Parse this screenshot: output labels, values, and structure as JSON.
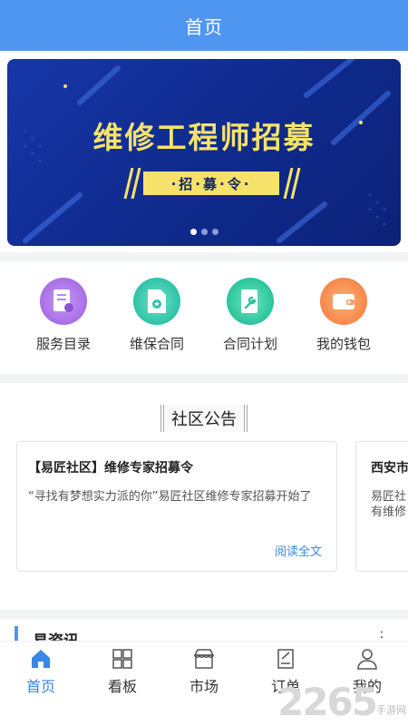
{
  "header": {
    "title": "首页"
  },
  "banner": {
    "title": "维修工程师招募",
    "tag": "·招·募·令·",
    "slides": 3,
    "active_slide": 0
  },
  "menu": {
    "items": [
      {
        "label": "服务目录",
        "icon": "certificate-icon",
        "color": "#a86ee6"
      },
      {
        "label": "维保合同",
        "icon": "contract-icon",
        "color": "#2fc2a8"
      },
      {
        "label": "合同计划",
        "icon": "wrench-doc-icon",
        "color": "#2bc49c"
      },
      {
        "label": "我的钱包",
        "icon": "wallet-icon",
        "color": "#f7874a"
      }
    ]
  },
  "notice": {
    "section_title": "社区公告",
    "cards": [
      {
        "title": "【易匠社区】维修专家招募令",
        "body": "“寻找有梦想实力派的你”易匠社区维修专家招募开始了",
        "more": "阅读全文"
      },
      {
        "title": "西安市",
        "body": "易匠社\n有维修",
        "more": ""
      }
    ]
  },
  "info": {
    "title": "易资讯",
    "more": "⋮"
  },
  "tabbar": {
    "items": [
      {
        "label": "首页",
        "icon": "home-icon",
        "active": true
      },
      {
        "label": "看板",
        "icon": "grid-icon",
        "active": false
      },
      {
        "label": "市场",
        "icon": "market-icon",
        "active": false
      },
      {
        "label": "订单",
        "icon": "order-icon",
        "active": false
      },
      {
        "label": "我的",
        "icon": "user-icon",
        "active": false
      }
    ]
  },
  "watermark": {
    "num": "2265",
    "sub": "手游网"
  },
  "colors": {
    "primary": "#4f96f0",
    "link": "#3a86e6",
    "banner_yellow": "#f6e26a"
  }
}
